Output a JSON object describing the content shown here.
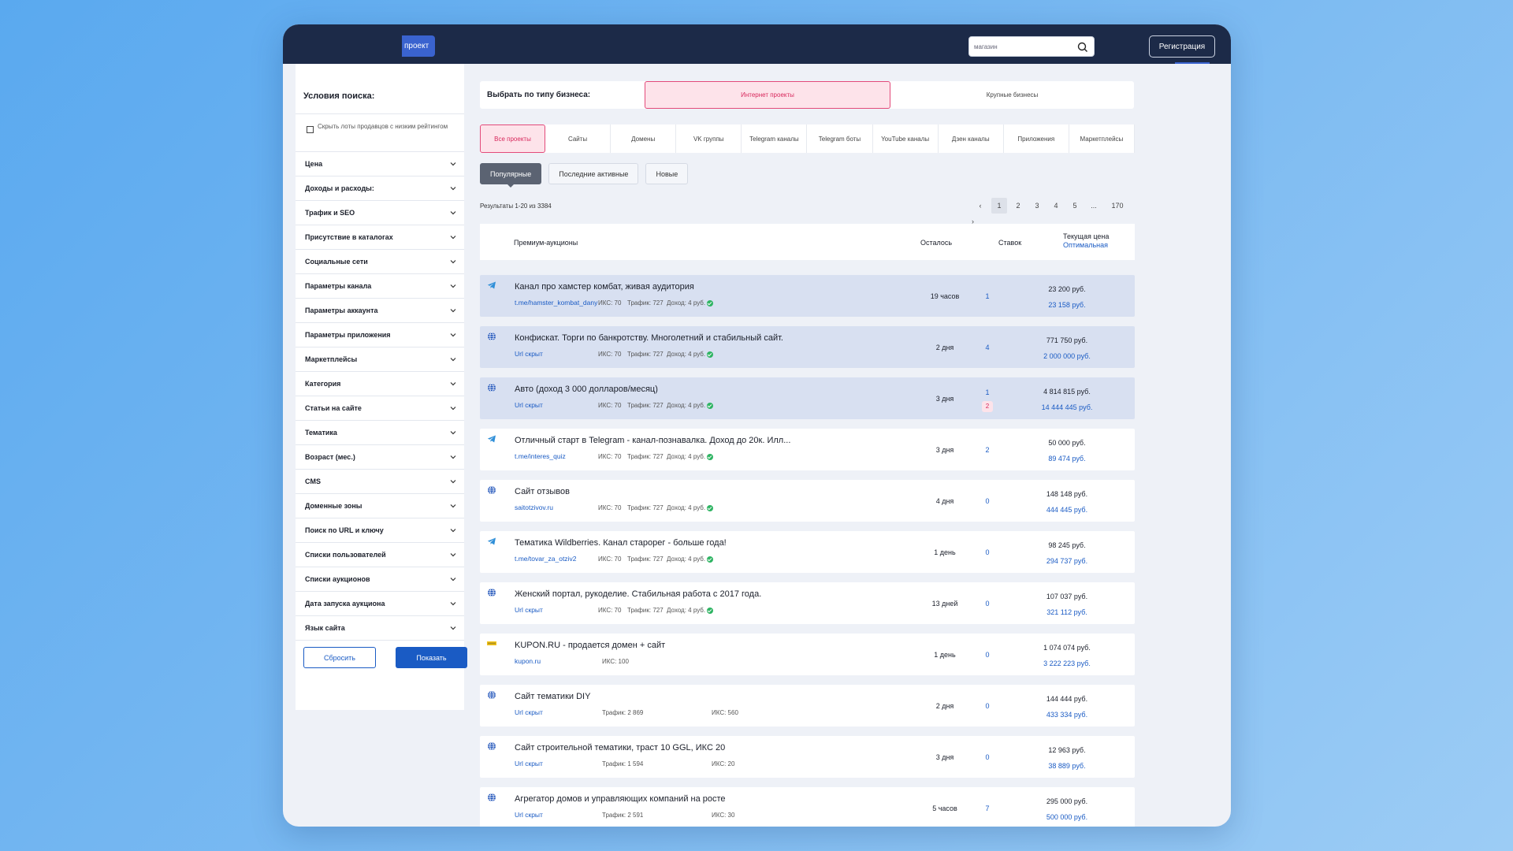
{
  "header": {
    "add_project_label": "проект",
    "search_value": "магазин",
    "register_label": "Регистрация"
  },
  "sidebar": {
    "title": "Условия поиска:",
    "hide_low_rating_label": "Скрыть лоты продавцов с низким рейтингом",
    "filters": [
      "Цена",
      "Доходы и расходы:",
      "Трафик и SEO",
      "Присутствие в каталогах",
      "Социальные сети",
      "Параметры канала",
      "Параметры аккаунта",
      "Параметры приложения",
      "Маркетплейсы",
      "Категория",
      "Статьи на сайте",
      "Тематика",
      "Возраст (мес.)",
      "CMS",
      "Доменные зоны",
      "Поиск по URL и ключу",
      "Списки пользователей",
      "Списки аукционов",
      "Дата запуска аукциона",
      "Язык сайта"
    ],
    "reset_label": "Сбросить",
    "show_label": "Показать"
  },
  "business_type": {
    "label": "Выбрать по типу бизнеса:",
    "options": [
      "Интернет проекты",
      "Крупные бизнесы"
    ],
    "selected": "Интернет проекты"
  },
  "categories": [
    "Все проекты",
    "Сайты",
    "Домены",
    "VK группы",
    "Telegram каналы",
    "Telegram боты",
    "YouTube каналы",
    "Дзен каналы",
    "Приложения",
    "Маркетплейсы"
  ],
  "sort_tabs": [
    "Популярные",
    "Последние активные",
    "Новые"
  ],
  "results": {
    "count_label": "Результаты 1-20 из 3384",
    "pages": [
      "‹",
      "1",
      "2",
      "3",
      "4",
      "5",
      "...",
      "170"
    ],
    "current_page": "1",
    "next": "›"
  },
  "table": {
    "col_name": "Премиум-аукционы",
    "col_left": "Осталось",
    "col_bids": "Ставок",
    "col_price": "Текущая цена",
    "col_price_sub": "Оптимальная"
  },
  "lots": [
    {
      "icon": "telegram-icon",
      "premium": true,
      "title": "Канал про хамстер комбат, живая аудитория",
      "link": "t.me/hamster_kombat_dany",
      "iks": "ИКС: 70",
      "traffic": "Трафик: 727",
      "income": "Доход: 4 руб.",
      "verified": true,
      "left": "19 часов",
      "bids": "1",
      "price": "23 200 руб.",
      "optimal": "23 158 руб."
    },
    {
      "icon": "globe-icon",
      "premium": true,
      "title": "Конфискат. Торги по банкротству. Многолетний и стабильный сайт.",
      "link": "Url скрыт",
      "iks": "ИКС: 70",
      "traffic": "Трафик: 727",
      "income": "Доход: 4 руб.",
      "verified": true,
      "left": "2 дня",
      "bids": "4",
      "price": "771 750 руб.",
      "optimal": "2 000 000 руб."
    },
    {
      "icon": "globe-icon",
      "premium": true,
      "title": "Авто (доход 3 000 долларов/месяц)",
      "link": "Url скрыт",
      "iks": "ИКС: 70",
      "traffic": "Трафик: 727",
      "income": "Доход: 4 руб.",
      "verified": true,
      "left": "3 дня",
      "bids": "1",
      "bids_extra": "2",
      "price": "4 814 815 руб.",
      "optimal": "14 444 445 руб."
    },
    {
      "icon": "telegram-icon",
      "premium": false,
      "title": "Отличный старт в Telegram - канал-познавалка. Доход до 20к. Илл...",
      "link": "t.me/interes_quiz",
      "iks": "ИКС: 70",
      "traffic": "Трафик: 727",
      "income": "Доход: 4 руб.",
      "verified": true,
      "left": "3 дня",
      "bids": "2",
      "price": "50 000 руб.",
      "optimal": "89 474 руб."
    },
    {
      "icon": "globe-icon",
      "premium": false,
      "title": "Сайт отзывов",
      "link": "saitotzivov.ru",
      "iks": "ИКС: 70",
      "traffic": "Трафик: 727",
      "income": "Доход: 4 руб.",
      "verified": true,
      "left": "4 дня",
      "bids": "0",
      "price": "148 148 руб.",
      "optimal": "444 445 руб."
    },
    {
      "icon": "telegram-icon",
      "premium": false,
      "title": "Тематика Wildberries. Канал старорег - больше года!",
      "link": "t.me/tovar_za_otziv2",
      "iks": "ИКС: 70",
      "traffic": "Трафик: 727",
      "income": "Доход: 4 руб.",
      "verified": true,
      "left": "1 день",
      "bids": "0",
      "price": "98 245 руб.",
      "optimal": "294 737 руб."
    },
    {
      "icon": "globe-icon",
      "premium": false,
      "title": "Женский портал, рукоделие. Стабильная работа с 2017 года.",
      "link": "Url скрыт",
      "iks": "ИКС: 70",
      "traffic": "Трафик: 727",
      "income": "Доход: 4 руб.",
      "verified": true,
      "left": "13 дней",
      "bids": "0",
      "price": "107 037 руб.",
      "optimal": "321 112 руб."
    },
    {
      "icon": "kupon-logo-icon",
      "premium": false,
      "title": "KUPON.RU - продается домен + сайт",
      "link": "kupon.ru",
      "iks": "ИКС: 100",
      "traffic": "",
      "income": "",
      "verified": false,
      "left": "1 день",
      "bids": "0",
      "price": "1 074 074 руб.",
      "optimal": "3 222 223 руб."
    },
    {
      "icon": "globe-icon",
      "premium": false,
      "title": "Сайт тематики DIY",
      "link": "Url скрыт",
      "iks": "",
      "traffic": "Трафик: 2 869",
      "income": "",
      "iks2": "ИКС: 560",
      "verified": false,
      "left": "2 дня",
      "bids": "0",
      "price": "144 444 руб.",
      "optimal": "433 334 руб."
    },
    {
      "icon": "globe-icon",
      "premium": false,
      "title": "Сайт строительной тематики, траст 10 GGL, ИКС 20",
      "link": "Url скрыт",
      "iks": "",
      "traffic": "Трафик: 1 594",
      "income": "",
      "iks2": "ИКС: 20",
      "verified": false,
      "left": "3 дня",
      "bids": "0",
      "price": "12 963 руб.",
      "optimal": "38 889 руб."
    },
    {
      "icon": "globe-icon",
      "premium": false,
      "title": "Агрегатор домов и управляющих компаний на росте",
      "link": "Url скрыт",
      "iks": "",
      "traffic": "Трафик: 2 591",
      "income": "",
      "iks2": "ИКС: 30",
      "verified": false,
      "left": "5 часов",
      "bids": "7",
      "price": "295 000 руб.",
      "optimal": "500 000 руб."
    }
  ]
}
